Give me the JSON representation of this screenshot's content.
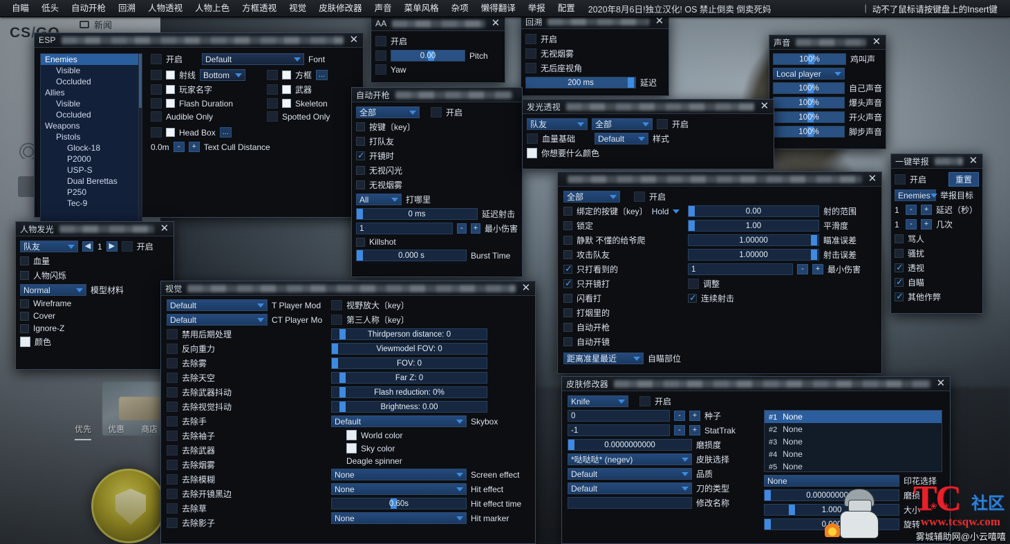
{
  "topbar": {
    "menu_items": [
      "自瞄",
      "低头",
      "自动开枪",
      "回溯",
      "人物透视",
      "人物上色",
      "方框透视",
      "视觉",
      "皮肤修改器",
      "声音",
      "菜单风格",
      "杂项",
      "懒得翻译",
      "举报",
      "配置"
    ],
    "note": "2020年8月6日!独立汉化! OS 禁止倒卖 倒卖死妈",
    "bar": "|",
    "right_hint": "动不了鼠标请按键盘上的Insert键"
  },
  "background": {
    "logo_cs": "CS",
    "logo_slash": "/",
    "logo_go": "GO",
    "news_tab": "新闻",
    "store_tabs": [
      "优先",
      "优惠",
      "商店"
    ]
  },
  "esp": {
    "title": "ESP",
    "close": "✕",
    "tree": [
      {
        "label": "Enemies",
        "indent": 0,
        "selected": true
      },
      {
        "label": "Visible",
        "indent": 1,
        "selected": false
      },
      {
        "label": "Occluded",
        "indent": 1,
        "selected": false
      },
      {
        "label": "Allies",
        "indent": 0,
        "selected": false
      },
      {
        "label": "Visible",
        "indent": 1,
        "selected": false
      },
      {
        "label": "Occluded",
        "indent": 1,
        "selected": false
      },
      {
        "label": "Weapons",
        "indent": 0,
        "selected": false
      },
      {
        "label": "Pistols",
        "indent": 1,
        "selected": false
      },
      {
        "label": "Glock-18",
        "indent": 2,
        "selected": false
      },
      {
        "label": "P2000",
        "indent": 2,
        "selected": false
      },
      {
        "label": "USP-S",
        "indent": 2,
        "selected": false
      },
      {
        "label": "Dual Berettas",
        "indent": 2,
        "selected": false
      },
      {
        "label": "P250",
        "indent": 2,
        "selected": false
      },
      {
        "label": "Tec-9",
        "indent": 2,
        "selected": false
      }
    ],
    "enable_label": "开启",
    "font_value": "Default",
    "font_label": "Font",
    "left_options": [
      {
        "label": "射线",
        "type": "combo",
        "value": "Bottom"
      },
      {
        "label": "玩家名字",
        "type": "check"
      },
      {
        "label": "Flash Duration",
        "type": "check"
      }
    ],
    "audible_only": "Audible Only",
    "right_options": [
      {
        "label": "方框",
        "type": "ellipsis"
      },
      {
        "label": "武器",
        "type": "check"
      },
      {
        "label": "Skeleton",
        "type": "check"
      }
    ],
    "spotted_only": "Spotted Only",
    "head_box": "Head Box",
    "cull_value": "0.0m",
    "cull_minus": "-",
    "cull_plus": "+",
    "cull_label": "Text Cull Distance"
  },
  "aa": {
    "title": "AA",
    "close": "✕",
    "enable_label": "开启",
    "pitch_value": "0.00",
    "pitch_label": "Pitch",
    "yaw_label": "Yaw"
  },
  "backtrack": {
    "title": "回溯",
    "close": "✕",
    "options": [
      "开启",
      "无视烟雾",
      "无后座视角"
    ],
    "delay_value": "200 ms",
    "delay_label": "延迟"
  },
  "sound": {
    "title": "声音",
    "close": "✕",
    "rows": [
      {
        "value": "100%",
        "label": "鸡叫声"
      },
      {
        "value": "100%",
        "label": "自己声音"
      },
      {
        "value": "100%",
        "label": "爆头声音"
      },
      {
        "value": "100%",
        "label": "开火声音"
      },
      {
        "value": "100%",
        "label": "脚步声音"
      }
    ],
    "player_select": "Local player"
  },
  "triggerbot": {
    "title": "自动开枪",
    "weapon_select": "全部",
    "enable_label": "开启",
    "checks": [
      {
        "label": "按键〔key〕",
        "checked": false
      },
      {
        "label": "打队友",
        "checked": false
      },
      {
        "label": "开镜时",
        "checked": true
      },
      {
        "label": "无视闪光",
        "checked": false
      },
      {
        "label": "无视烟雾",
        "checked": false
      }
    ],
    "hitbox_select": "All",
    "hitbox_label": "打哪里",
    "delay_value": "0 ms",
    "delay_label": "延迟射击",
    "mindmg_value": "1",
    "mindmg_minus": "-",
    "mindmg_plus": "+",
    "mindmg_label": "最小伤害",
    "killshot_label": "Killshot",
    "burst_value": "0.000 s",
    "burst_label": "Burst Time"
  },
  "glow": {
    "title": "发光透视",
    "close": "✕",
    "target_select": "队友",
    "scope_select": "全部",
    "enable_label": "开启",
    "health_based": "血量基础",
    "style_value": "Default",
    "style_label": "样式",
    "color_label": "你想要什么颜色"
  },
  "aimbot": {
    "close": "✕",
    "weapon_select": "全部",
    "enable_label": "开启",
    "left_checks": [
      {
        "label": "绑定的按键〔key〕",
        "checked": false,
        "combo": "Hold"
      },
      {
        "label": "锁定",
        "checked": false
      },
      {
        "label": "静默 不懂的给爷爬",
        "checked": false
      },
      {
        "label": "攻击队友",
        "checked": false
      },
      {
        "label": "只打看到的",
        "checked": true
      },
      {
        "label": "只开镜打",
        "checked": true
      },
      {
        "label": "闪看打",
        "checked": false
      },
      {
        "label": "打烟里的",
        "checked": false
      },
      {
        "label": "自动开枪",
        "checked": false
      },
      {
        "label": "自动开镜",
        "checked": false
      }
    ],
    "sliders": [
      {
        "value": "0.00",
        "label": "射的范围",
        "pct": 4
      },
      {
        "value": "1.00",
        "label": "平滑度",
        "pct": 4
      },
      {
        "value": "1.00000",
        "label": "瞄准误差",
        "pct": 92
      },
      {
        "value": "1.00000",
        "label": "射击误差",
        "pct": 92
      }
    ],
    "mindmg_value": "1",
    "mindmg_minus": "-",
    "mindmg_plus": "+",
    "mindmg_label": "最小伤害",
    "adjust_label": "调整",
    "autoshoot_label": "连续射击",
    "autoshoot_checked": true,
    "hitbox_select": "距离准星最近",
    "hitbox_label": "自瞄部位"
  },
  "report": {
    "title": "一键举报",
    "close": "✕",
    "enable_label": "开启",
    "reset_label": "重置",
    "target_select": "Enemies",
    "target_label": "举报目标",
    "delay_value": "1",
    "delay_label": "延迟（秒）",
    "count_value": "1",
    "count_label": "几次",
    "minus": "-",
    "plus": "+",
    "checks": [
      {
        "label": "骂人",
        "checked": false
      },
      {
        "label": "骚扰",
        "checked": false
      },
      {
        "label": "透视",
        "checked": true
      },
      {
        "label": "自瞄",
        "checked": true
      },
      {
        "label": "其他作弊",
        "checked": true
      }
    ]
  },
  "playerglow": {
    "title": "人物发光",
    "close": "✕",
    "target_select": "队友",
    "prev": "◀",
    "index": "1",
    "next": "▶",
    "enable_label": "开启",
    "checks": [
      {
        "label": "血量",
        "checked": false
      },
      {
        "label": "人物闪烁",
        "checked": false
      }
    ],
    "material_select": "Normal",
    "material_label": "模型材料",
    "checks2": [
      {
        "label": "Wireframe",
        "checked": false
      },
      {
        "label": "Cover",
        "checked": false
      },
      {
        "label": "Ignore-Z",
        "checked": false
      }
    ],
    "color_label": "颜色"
  },
  "visuals": {
    "title": "视觉",
    "close": "✕",
    "t_model_value": "Default",
    "t_model_label": "T Player Mod",
    "ct_model_value": "Default",
    "ct_model_label": "CT Player Mo",
    "zoom_label": "视野放大〔key〕",
    "thirdperson_label": "第三人称〔key〕",
    "left_checks": [
      "禁用后期处理",
      "反向重力",
      "去除雾",
      "去除天空",
      "去除武器抖动",
      "去除视觉抖动",
      "去除手",
      "去除袖子",
      "去除武器",
      "去除烟雾",
      "去除模糊",
      "去除开镜黑边",
      "去除草",
      "去除影子"
    ],
    "sliders": [
      {
        "text": "Thirdperson distance: 0",
        "pct": 5
      },
      {
        "text": "Viewmodel FOV: 0",
        "pct": 0
      },
      {
        "text": "FOV: 0",
        "pct": 0
      },
      {
        "text": "Far Z: 0",
        "pct": 5
      },
      {
        "text": "Flash reduction: 0%",
        "pct": 5
      },
      {
        "text": "Brightness: 0.00",
        "pct": 5
      }
    ],
    "skybox_value": "Default",
    "skybox_label": "Skybox",
    "world_color_label": "World color",
    "sky_color_label": "Sky color",
    "deagle_spinner_label": "Deagle spinner",
    "screen_effect_value": "None",
    "screen_effect_label": "Screen effect",
    "hit_effect_value": "None",
    "hit_effect_label": "Hit effect",
    "hit_effect_time_value": "0.60s",
    "hit_effect_time_label": "Hit effect time",
    "hit_marker_value": "None",
    "hit_marker_label": "Hit marker"
  },
  "skinchanger": {
    "title": "皮肤修改器",
    "close": "✕",
    "weapon_select": "Knife",
    "enable_label": "开启",
    "seed_value": "0",
    "seed_label": "种子",
    "stattrak_value": "-1",
    "stattrak_label": "StatTrak",
    "wear_value": "0.0000000000",
    "wear_label": "磨损度",
    "minus": "-",
    "plus": "+",
    "skin_value": "*哒哒哒* (negev)",
    "skin_label": "皮肤选择",
    "quality_value": "Default",
    "quality_label": "品质",
    "knife_value": "Default",
    "knife_label": "刀的类型",
    "rename_value": "",
    "rename_label": "修改名称",
    "sticker_slots": [
      {
        "idx": "#1",
        "value": "None",
        "selected": true
      },
      {
        "idx": "#2",
        "value": "None",
        "selected": false
      },
      {
        "idx": "#3",
        "value": "None",
        "selected": false
      },
      {
        "idx": "#4",
        "value": "None",
        "selected": false
      },
      {
        "idx": "#5",
        "value": "None",
        "selected": false
      }
    ],
    "sticker_select_value": "None",
    "sticker_select_label": "印花选择",
    "sticker_wear_value": "0.0000000000",
    "sticker_wear_label": "磨损",
    "sticker_size_value": "1.000",
    "sticker_size_label": "大小",
    "sticker_rot_value": "0.000",
    "sticker_rot_label": "旋转"
  },
  "watermark": {
    "tc": "TC",
    "community": "社区",
    "url": "www.tcsqw.com",
    "sub": "雾城辅助网@小云嘻嘻",
    "paws": "❀ ❀"
  }
}
